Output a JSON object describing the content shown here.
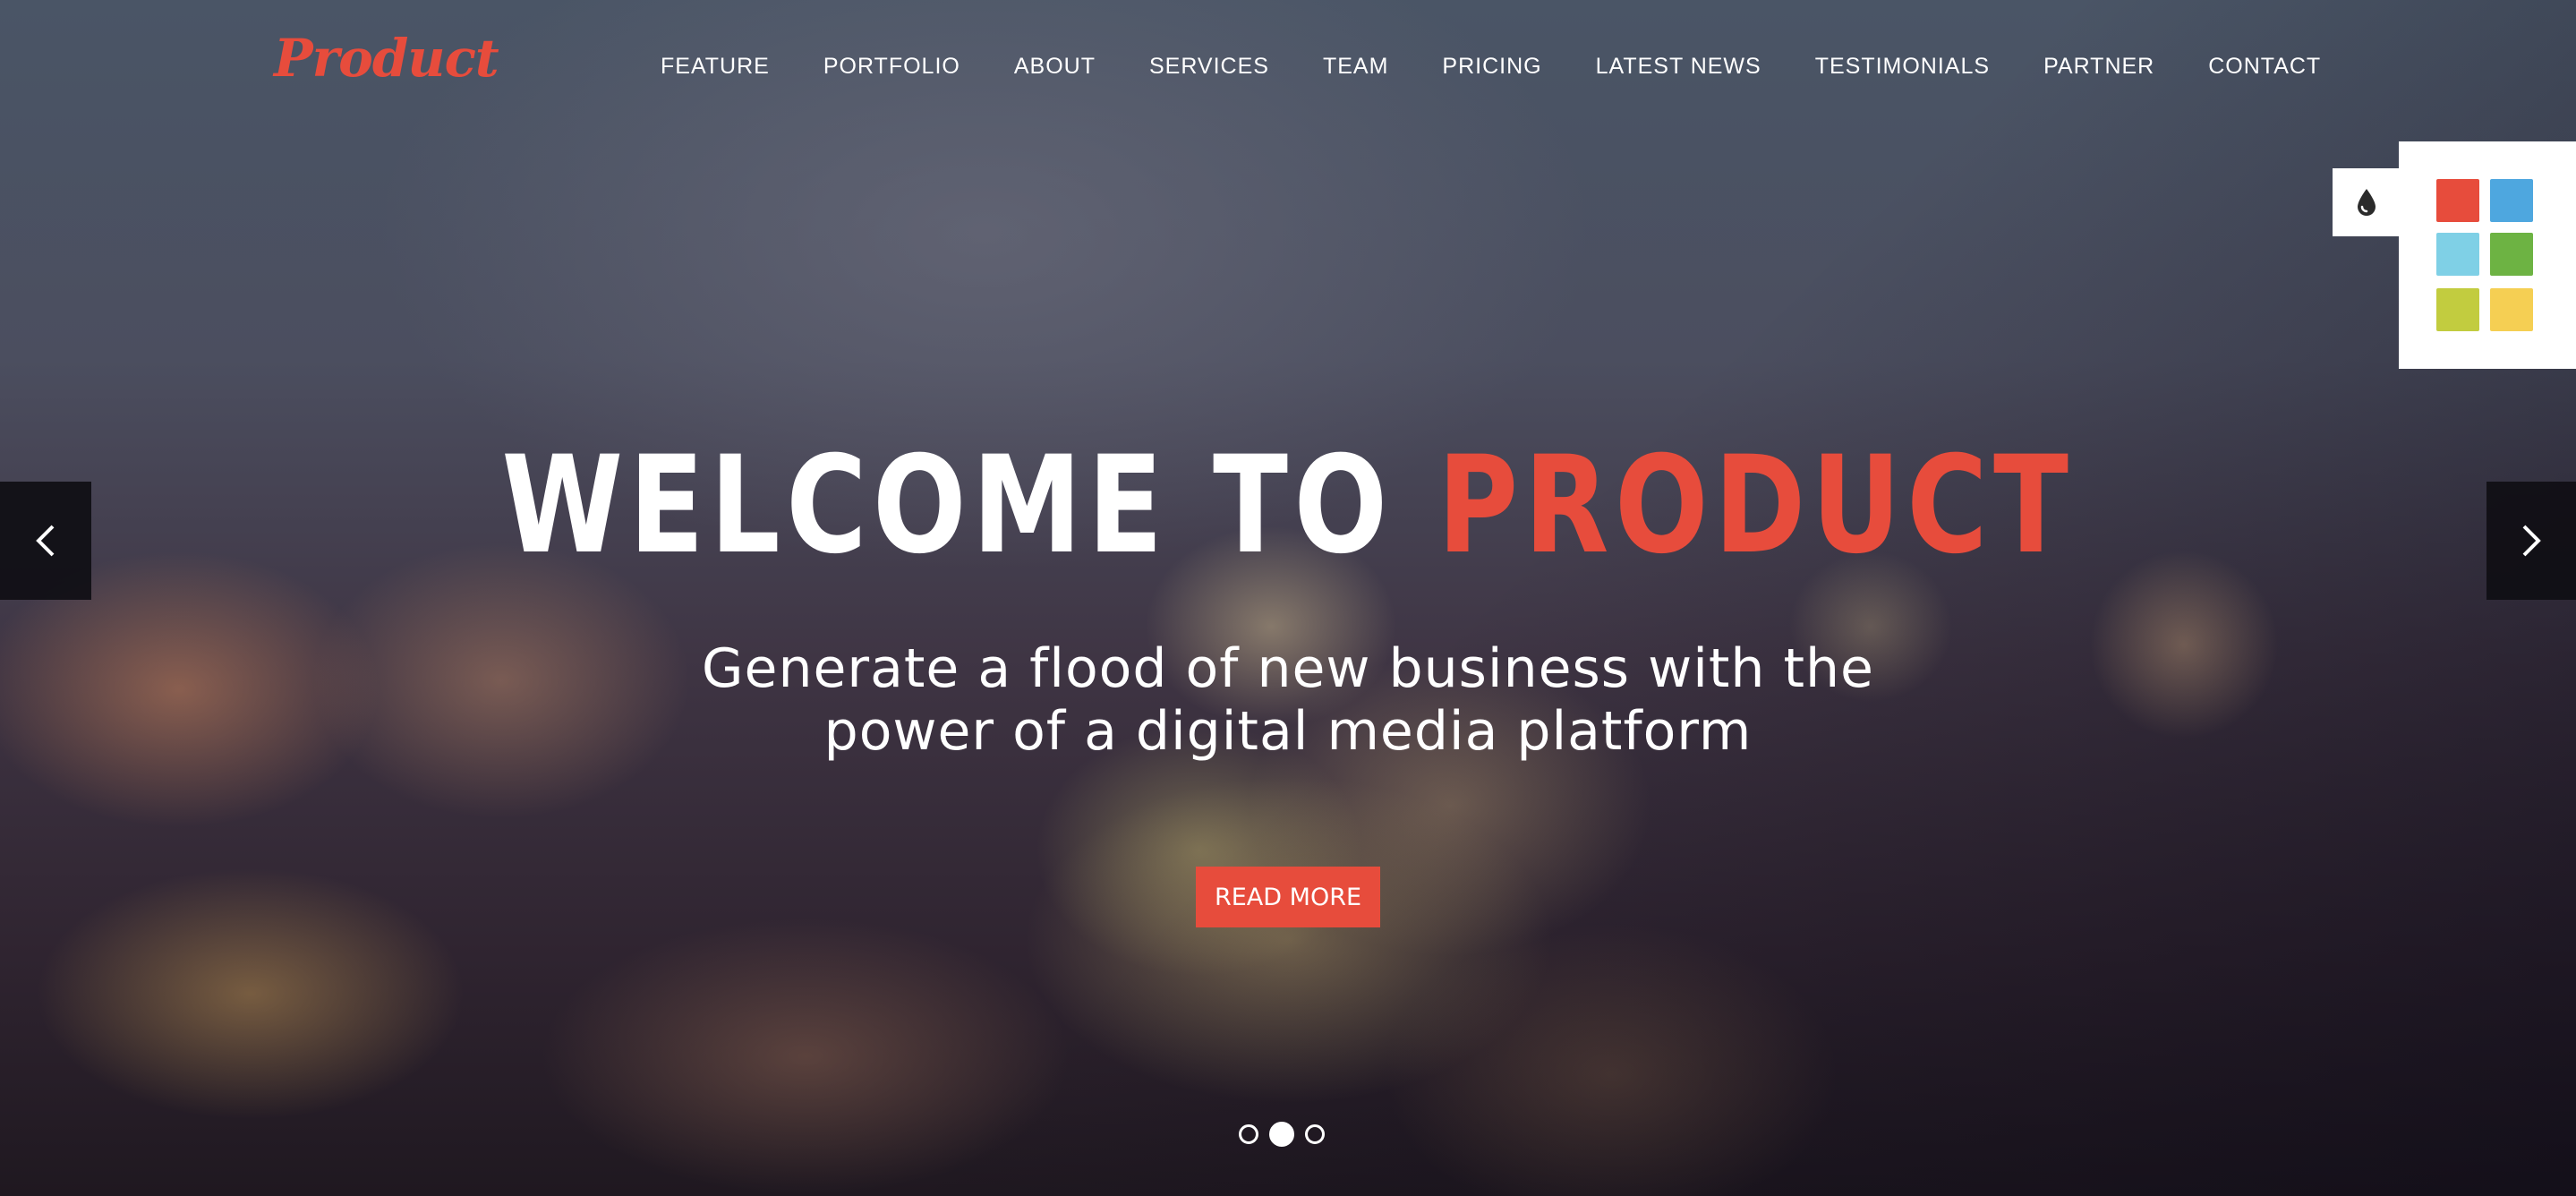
{
  "brand": {
    "logo": "Product",
    "accent_color": "#e74c3c"
  },
  "nav": {
    "items": [
      "FEATURE",
      "PORTFOLIO",
      "ABOUT",
      "SERVICES",
      "TEAM",
      "PRICING",
      "LATEST NEWS",
      "TESTIMONIALS",
      "PARTNER",
      "CONTACT"
    ]
  },
  "color_switcher": {
    "icon": "droplet-icon",
    "swatches": [
      {
        "name": "red",
        "color": "#e74c3c"
      },
      {
        "name": "blue",
        "color": "#4ea7df"
      },
      {
        "name": "light-blue",
        "color": "#7fd0e6"
      },
      {
        "name": "green",
        "color": "#6db343"
      },
      {
        "name": "lime",
        "color": "#c2cc3f"
      },
      {
        "name": "yellow",
        "color": "#f5cf53"
      }
    ]
  },
  "slider": {
    "prev_icon": "chevron-left-icon",
    "next_icon": "chevron-right-icon",
    "title_prefix": "WELCOME TO",
    "title_highlight": "PRODUCT",
    "subtitle_line1": "Generate a flood of new business with the",
    "subtitle_line2": "power of a digital media platform",
    "cta_label": "READ MORE",
    "slide_count": 3,
    "active_slide": 2
  }
}
